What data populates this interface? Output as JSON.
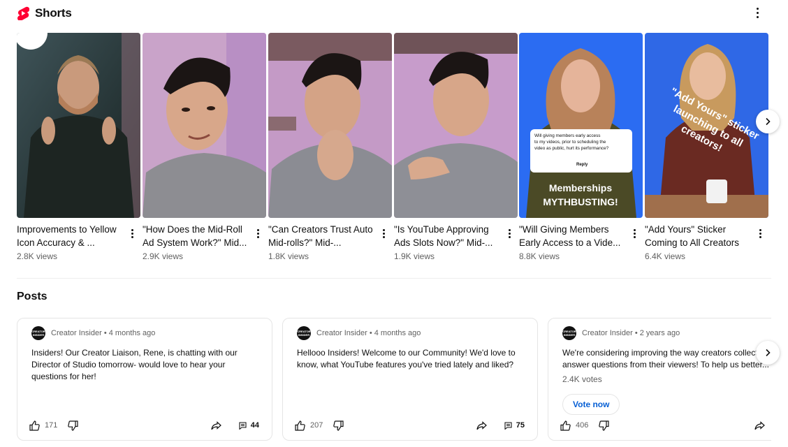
{
  "shorts": {
    "title": "Shorts",
    "items": [
      {
        "title": "Improvements to Yellow Icon Accuracy & ...",
        "views": "2.8K views"
      },
      {
        "title": "\"How Does the Mid-Roll Ad System Work?\" Mid...",
        "views": "2.9K views"
      },
      {
        "title": "\"Can Creators Trust Auto Mid-rolls?\" Mid-...",
        "views": "1.8K views"
      },
      {
        "title": "\"Is YouTube Approving Ads Slots Now?\" Mid-...",
        "views": "1.9K views"
      },
      {
        "title": "\"Will Giving Members Early Access to a Vide...",
        "views": "8.8K views"
      },
      {
        "title": "\"Add Yours\" Sticker Coming to All Creators",
        "views": "6.4K views"
      }
    ],
    "thumb_overlays": {
      "comment_card_text": "Will giving members early access to my videos, prior to scheduling the video as public, hurt its performance?",
      "comment_card_reply": "Reply",
      "memberships_line1": "Memberships",
      "memberships_line2": "MYTHBUSTING!",
      "sticker_line1": "\"Add Yours\" sticker",
      "sticker_line2": "launching to all",
      "sticker_line3": "creators!"
    }
  },
  "posts": {
    "title": "Posts",
    "items": [
      {
        "channel": "Creator Insider",
        "age": "4 months ago",
        "text": "Insiders! Our Creator Liaison, Rene, is chatting with our Director of Studio tomorrow- would love to hear your questions for her!",
        "likes": "171",
        "comments": "44"
      },
      {
        "channel": "Creator Insider",
        "age": "4 months ago",
        "text": "Hellooo Insiders! Welcome to our Community! We'd love to know, what YouTube features you've tried lately and liked?",
        "likes": "207",
        "comments": "75"
      },
      {
        "channel": "Creator Insider",
        "age": "2 years ago",
        "text": "We're considering improving the way creators collect answer questions from their viewers! To help us better...",
        "votes": "2.4K votes",
        "vote_label": "Vote now",
        "likes": "406",
        "comments": ""
      }
    ]
  },
  "avatar_text": "CREATOR INSIDER",
  "colors": {
    "shorts_red": "#ff0033",
    "link_blue": "#065fd4",
    "secondary_text": "#606060"
  }
}
